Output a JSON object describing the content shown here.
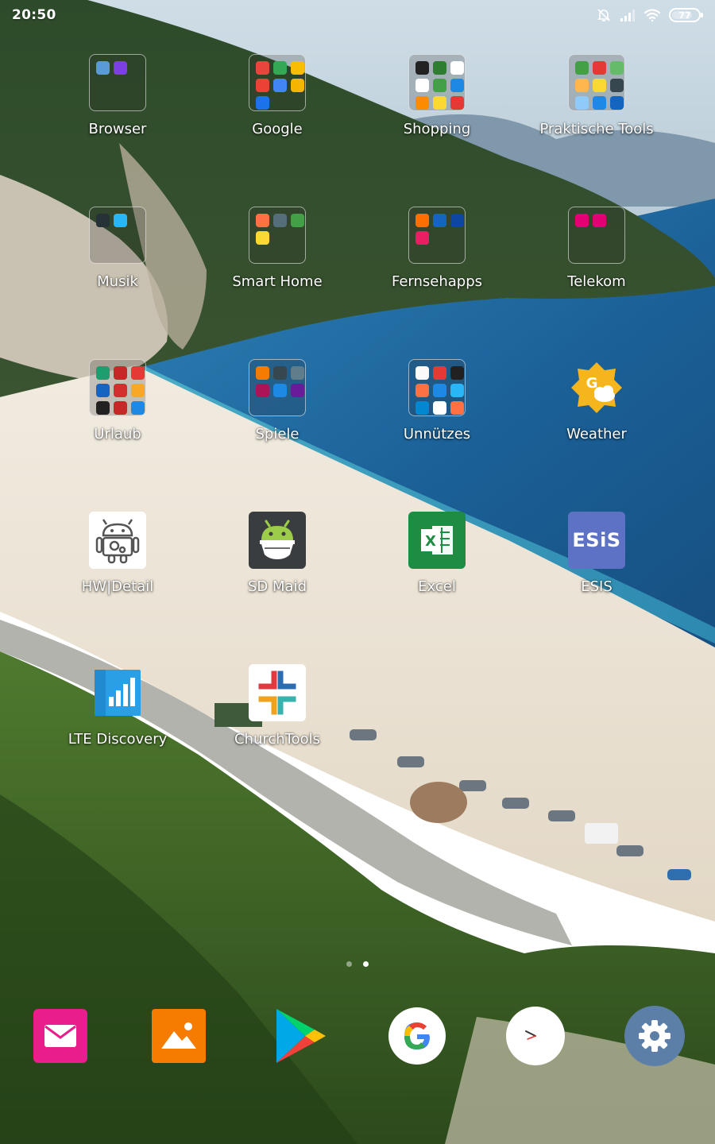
{
  "status_bar": {
    "time": "20:50",
    "battery_level": "77",
    "icons": [
      "silent-bell-icon",
      "signal-icon",
      "wifi-icon",
      "battery-icon"
    ]
  },
  "home": {
    "rows": [
      [
        {
          "label": "Browser",
          "type": "folder",
          "minis": [
            "#5b9bd5",
            "#7b3fe4"
          ]
        },
        {
          "label": "Google",
          "type": "folder",
          "minis": [
            "#e8453c",
            "#34a853",
            "#fbbc05",
            "#ea4335",
            "#4285f4",
            "#f4b400",
            "#1a73e8"
          ]
        },
        {
          "label": "Shopping",
          "type": "folder",
          "minis": [
            "#222222",
            "#2e7d32",
            "#ffffff",
            "#ffffff",
            "#43a047",
            "#1e88e5",
            "#fb8c00",
            "#fdd835",
            "#e53935"
          ]
        },
        {
          "label": "Praktische Tools",
          "type": "folder",
          "minis": [
            "#43a047",
            "#e53935",
            "#66bb6a",
            "#ffb74d",
            "#fdd835",
            "#37474f",
            "#90caf9",
            "#1e88e5",
            "#1565c0"
          ]
        }
      ],
      [
        {
          "label": "Musik",
          "type": "folder",
          "minis": [
            "#263238",
            "#29b6f6"
          ]
        },
        {
          "label": "Smart Home",
          "type": "folder",
          "minis": [
            "#ff7043",
            "#546e7a",
            "#43a047",
            "#fdd835"
          ]
        },
        {
          "label": "Fernsehapps",
          "type": "folder",
          "minis": [
            "#ff6f00",
            "#1565c0",
            "#0d47a1",
            "#e91e63"
          ]
        },
        {
          "label": "Telekom",
          "type": "folder",
          "minis": [
            "#e20074",
            "#e20074"
          ]
        }
      ],
      [
        {
          "label": "Urlaub",
          "type": "folder",
          "minis": [
            "#1e9e6f",
            "#c62828",
            "#e53935",
            "#1565c0",
            "#d32f2f",
            "#f9a825",
            "#212121",
            "#c62828",
            "#1e88e5"
          ]
        },
        {
          "label": "Spiele",
          "type": "folder",
          "minis": [
            "#f57c00",
            "#37474f",
            "#607d8b",
            "#ad1457",
            "#1e88e5",
            "#6a1b9a"
          ]
        },
        {
          "label": "Unnützes",
          "type": "folder",
          "minis": [
            "#fafafa",
            "#e53935",
            "#212121",
            "#ff7043",
            "#1e88e5",
            "#29b6f6",
            "#0288d1",
            "#ffffff",
            "#ff7043"
          ]
        },
        {
          "label": "Weather",
          "type": "app",
          "icon": "weather-icon"
        }
      ],
      [
        {
          "label": "HW|Detail",
          "type": "app",
          "icon": "android-robot-icon"
        },
        {
          "label": "SD Maid",
          "type": "app",
          "icon": "sd-maid-icon"
        },
        {
          "label": "Excel",
          "type": "app",
          "icon": "excel-icon"
        },
        {
          "label": "ESIS",
          "type": "app",
          "icon": "esis-icon",
          "icon_text": "ESiS"
        }
      ],
      [
        {
          "label": "LTE Discovery",
          "type": "app",
          "icon": "lte-signal-icon"
        },
        {
          "label": "ChurchTools",
          "type": "app",
          "icon": "churchtools-icon"
        }
      ]
    ]
  },
  "dock": [
    {
      "name": "email-app",
      "icon": "mail-icon",
      "color": "#e91e8c"
    },
    {
      "name": "gallery-app",
      "icon": "gallery-icon",
      "color": "#f57c00"
    },
    {
      "name": "play-store-app",
      "icon": "play-store-icon",
      "color": "#00c853"
    },
    {
      "name": "google-app",
      "icon": "google-g-icon",
      "color": "#ffffff"
    },
    {
      "name": "clock-app",
      "icon": "clock-icon",
      "color": "#ffffff"
    },
    {
      "name": "settings-app",
      "icon": "gear-icon",
      "color": "#5b7fa6"
    }
  ],
  "pages": {
    "count": 2,
    "active": 2
  },
  "colors": {
    "label_text": "#ffffff",
    "sea": "#1f6fa8",
    "sand": "#ece4d6",
    "hills": "#2c4a24"
  }
}
